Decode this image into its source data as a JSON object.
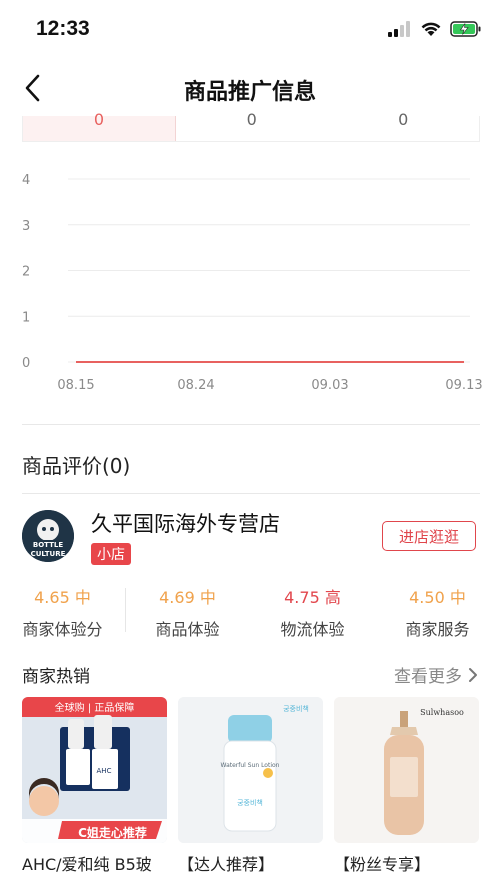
{
  "status_bar": {
    "time": "12:33"
  },
  "nav": {
    "title": "商品推广信息"
  },
  "tabs": [
    "0",
    "0",
    "0"
  ],
  "chart_data": {
    "type": "line",
    "x": [
      "08.15",
      "08.24",
      "09.03",
      "09.13"
    ],
    "y_ticks": [
      "0",
      "1",
      "2",
      "3",
      "4"
    ],
    "ylim": [
      0,
      4
    ],
    "series": [
      {
        "values": [
          0,
          0,
          0,
          0
        ],
        "color": "#e8615f"
      }
    ],
    "grid": true
  },
  "reviews": {
    "title": "商品评价(0)"
  },
  "shop": {
    "logo_text": "BOTTLE CULTURE",
    "name": "久平国际海外专营店",
    "badge": "小店",
    "visit_label": "进店逛逛",
    "scores": [
      {
        "value": "4.65",
        "level": "中",
        "label": "商家体验分",
        "high": false
      },
      {
        "value": "4.69",
        "level": "中",
        "label": "商品体验",
        "high": false
      },
      {
        "value": "4.75",
        "level": "高",
        "label": "物流体验",
        "high": true
      },
      {
        "value": "4.50",
        "level": "中",
        "label": "商家服务",
        "high": false
      }
    ]
  },
  "hot": {
    "title": "商家热销",
    "more_label": "查看更多",
    "products": [
      {
        "title": "AHC/爱和纯 B5玻",
        "banner": "全球购 | 正品保障",
        "promo": "C姐走心推荐",
        "brand": "AHC"
      },
      {
        "title": "【达人推荐】",
        "brand_kr": "궁중비책",
        "product_en": "Waterful Sun Lotion"
      },
      {
        "title": "【粉丝专享】",
        "brand": "Sulwhasoo"
      }
    ]
  },
  "colors": {
    "accent": "#e8464a",
    "score_mid": "#f0a24c",
    "score_high": "#e2474d",
    "chart_line": "#e8615f"
  }
}
